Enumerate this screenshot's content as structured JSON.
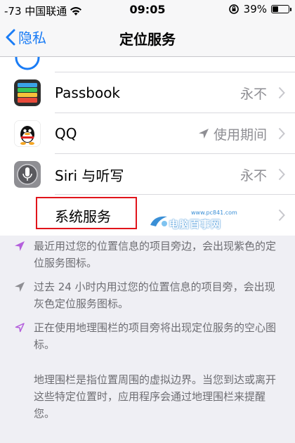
{
  "status_bar": {
    "carrier": "-73 中国联通",
    "time": "09:05",
    "battery_percent": "39%",
    "battery_level": 0.39
  },
  "nav": {
    "back_label": "隐私",
    "title": "定位服务"
  },
  "rows": [
    {
      "label": "Passbook",
      "value": "永不",
      "icon": "passbook-icon"
    },
    {
      "label": "QQ",
      "value": "使用期间",
      "icon": "qq-icon",
      "has_location_arrow": true
    },
    {
      "label": "Siri 与听写",
      "value": "永不",
      "icon": "siri-icon"
    },
    {
      "label": "系统服务",
      "value": "",
      "icon": ""
    }
  ],
  "watermark": {
    "site": "www.pc841.com",
    "name": "电脑百事网"
  },
  "footer": {
    "notes": [
      {
        "text": "最近用过您的位置信息的项目旁边，会出现紫色的定位服务图标。",
        "icon": "location-arrow-purple-icon",
        "color": "#b45fdc"
      },
      {
        "text": "过去 24 小时内用过您的位置信息的项目旁，会出现灰色定位服务图标。",
        "icon": "location-arrow-gray-icon",
        "color": "#8e8e93"
      },
      {
        "text": "正在使用地理围栏的项目旁将出现定位服务的空心图标。",
        "icon": "location-arrow-outline-icon",
        "color": "#b45fdc"
      }
    ],
    "paragraph": "地理围栏是指位置周围的虚拟边界。当您到达或离开这些特定位置时，应用程序会通过地理围栏来提醒您。"
  },
  "colors": {
    "accent": "#1a7cf5",
    "highlight": "#e1141b",
    "background": "#efeff4"
  }
}
